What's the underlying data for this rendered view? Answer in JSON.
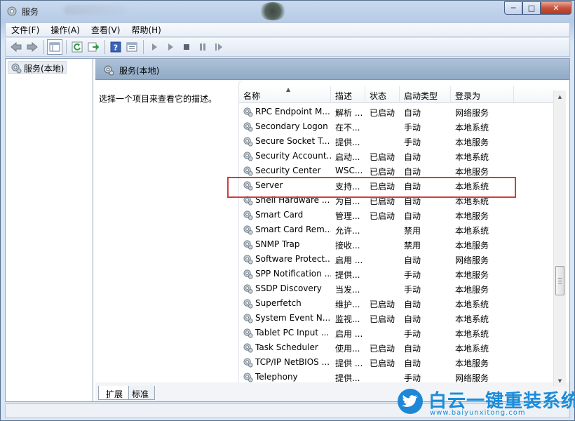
{
  "window": {
    "title": "服务",
    "controls": {
      "minimize": "─",
      "maximize": "□",
      "close": "✕"
    }
  },
  "menu": [
    "文件(F)",
    "操作(A)",
    "查看(V)",
    "帮助(H)"
  ],
  "toolbar_icons": [
    "back-arrow-icon",
    "forward-arrow-icon",
    "console-tree-icon",
    "refresh-icon",
    "export-list-icon",
    "help-icon",
    "properties-icon",
    "start-service-icon",
    "start-service-alt-icon",
    "stop-service-icon",
    "pause-service-icon",
    "restart-service-icon"
  ],
  "tree": {
    "root_label": "服务(本地)"
  },
  "panel": {
    "title": "服务(本地)",
    "description_hint": "选择一个项目来查看它的描述。"
  },
  "columns": [
    "名称",
    "描述",
    "状态",
    "启动类型",
    "登录为"
  ],
  "rows": [
    [
      "RPC Endpoint M...",
      "解析 ...",
      "已启动",
      "自动",
      "网络服务"
    ],
    [
      "Secondary Logon",
      "在不...",
      "",
      "手动",
      "本地系统"
    ],
    [
      "Secure Socket T...",
      "提供...",
      "",
      "手动",
      "本地服务"
    ],
    [
      "Security Account...",
      "启动...",
      "已启动",
      "自动",
      "本地系统"
    ],
    [
      "Security Center",
      "WSC...",
      "已启动",
      "自动",
      "本地服务"
    ],
    [
      "Server",
      "支持...",
      "已启动",
      "自动",
      "本地系统"
    ],
    [
      "Shell Hardware ...",
      "为自...",
      "已启动",
      "自动",
      "本地系统"
    ],
    [
      "Smart Card",
      "管理...",
      "已启动",
      "自动",
      "本地服务"
    ],
    [
      "Smart Card Rem...",
      "允许...",
      "",
      "禁用",
      "本地系统"
    ],
    [
      "SNMP Trap",
      "接收...",
      "",
      "禁用",
      "本地服务"
    ],
    [
      "Software Protect...",
      "启用 ...",
      "",
      "自动",
      "网络服务"
    ],
    [
      "SPP Notification ...",
      "提供...",
      "",
      "手动",
      "本地服务"
    ],
    [
      "SSDP Discovery",
      "当发...",
      "",
      "手动",
      "本地服务"
    ],
    [
      "Superfetch",
      "维护...",
      "已启动",
      "自动",
      "本地系统"
    ],
    [
      "System Event N...",
      "监视...",
      "已启动",
      "自动",
      "本地系统"
    ],
    [
      "Tablet PC Input ...",
      "启用 ...",
      "",
      "手动",
      "本地系统"
    ],
    [
      "Task Scheduler",
      "使用...",
      "已启动",
      "自动",
      "本地系统"
    ],
    [
      "TCP/IP NetBIOS ...",
      "提供 ...",
      "已启动",
      "自动",
      "本地服务"
    ],
    [
      "Telephony",
      "提供...",
      "",
      "手动",
      "网络服务"
    ]
  ],
  "tabs": [
    "扩展",
    "标准"
  ],
  "watermark": {
    "title": "白云一键重装系统",
    "url": "www.baiyunxitong.com"
  },
  "colors": {
    "highlight_box": "#d73a3a",
    "header_blue": "#91aac6",
    "watermark_blue": "#1b8cd8"
  }
}
